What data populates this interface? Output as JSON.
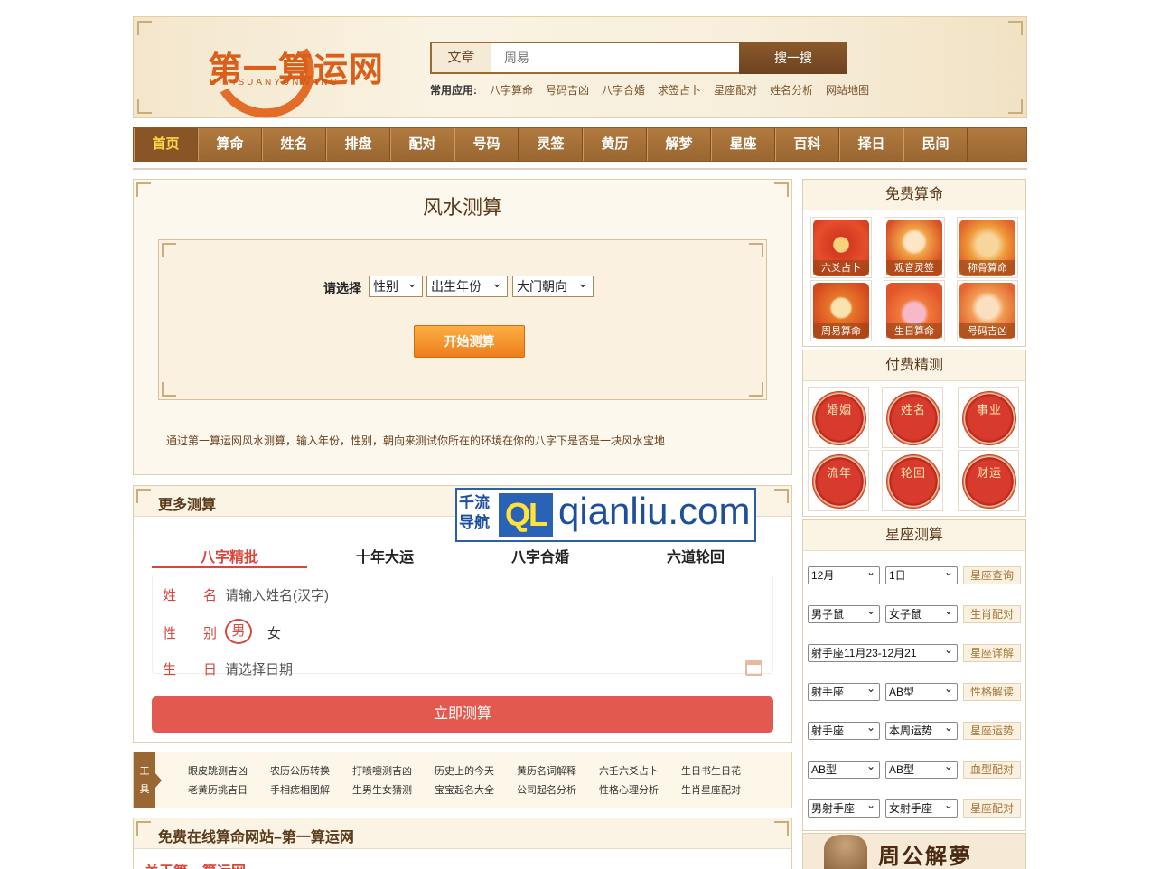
{
  "header": {
    "logo_text": "第一算运网",
    "logo_sub": "DIYISUANYUNWANG",
    "search_type": "文章",
    "search_placeholder": "周易",
    "search_button": "搜一搜",
    "common_label": "常用应用:",
    "common_links": [
      "八字算命",
      "号码吉凶",
      "八字合婚",
      "求签占卜",
      "星座配对",
      "姓名分析",
      "网站地图"
    ]
  },
  "nav": [
    "首页",
    "算命",
    "姓名",
    "排盘",
    "配对",
    "号码",
    "灵签",
    "黄历",
    "解梦",
    "星座",
    "百科",
    "择日",
    "民间"
  ],
  "fengshui": {
    "title": "风水测算",
    "select_label": "请选择",
    "selects": [
      "性别",
      "出生年份",
      "大门朝向"
    ],
    "start_button": "开始测算",
    "description": "通过第一算运网风水测算，输入年份，性别，朝向来测试你所在的环境在你的八字下是否是一块风水宝地"
  },
  "more": {
    "title": "更多测算",
    "watermark_left": [
      "千流",
      "导航"
    ],
    "watermark_mark": "QL",
    "watermark_url": "qianliu.com",
    "tabs": [
      "八字精批",
      "十年大运",
      "八字合婚",
      "六道轮回"
    ],
    "name_label": "姓名",
    "name_placeholder": "请输入姓名(汉字)",
    "gender_label": "性别",
    "male": "男",
    "female": "女",
    "birth_label": "生日",
    "birth_placeholder": "请选择日期",
    "submit": "立即测算"
  },
  "tools": {
    "tag": [
      "工",
      "具"
    ],
    "row1": [
      "眼皮跳测吉凶",
      "农历公历转换",
      "打喷嚏测吉凶",
      "历史上的今天",
      "黄历名词解释",
      "六壬六爻占卜",
      "生日书生日花"
    ],
    "row2": [
      "老黄历挑吉日",
      "手相痣相图解",
      "生男生女猜测",
      "宝宝起名大全",
      "公司起名分析",
      "性格心理分析",
      "生肖星座配对"
    ]
  },
  "site": {
    "title": "免费在线算命网站–第一算运网",
    "about": "关于第一算运网"
  },
  "sidebar": {
    "free_title": "免费算命",
    "free_apps": [
      "六爻占卜",
      "观音灵签",
      "称骨算命",
      "周易算命",
      "生日算命",
      "号码吉凶"
    ],
    "paid_title": "付费精测",
    "paid": [
      "婚姻",
      "姓名",
      "事业",
      "流年",
      "轮回",
      "财运"
    ],
    "xingzuo_title": "星座测算",
    "xingzuo_rows": [
      {
        "a": "12月",
        "b": "1日",
        "btn": "星座查询"
      },
      {
        "a": "男子鼠",
        "b": "女子鼠",
        "btn": "生肖配对"
      },
      {
        "a": "射手座11月23-12月21",
        "btn": "星座详解"
      },
      {
        "a": "射手座",
        "b": "AB型",
        "btn": "性格解读"
      },
      {
        "a": "射手座",
        "b": "本周运势",
        "btn": "星座运势"
      },
      {
        "a": "AB型",
        "b": "AB型",
        "btn": "血型配对"
      },
      {
        "a": "男射手座",
        "b": "女射手座",
        "btn": "星座配对"
      }
    ],
    "dream_title": "周公解夢"
  }
}
